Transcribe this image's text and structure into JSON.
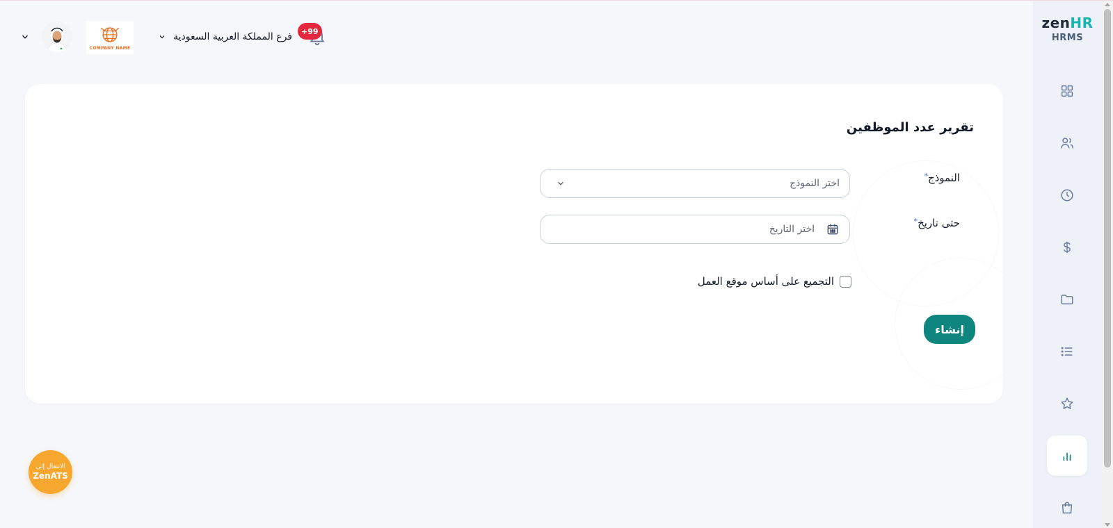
{
  "brand": {
    "logo_main": "zen",
    "logo_accent": "HR",
    "logo_sub": "HRMS",
    "accent_color": "#19b3b0",
    "primary_color": "#0f8580"
  },
  "sidebar": {
    "items": [
      {
        "icon": "dashboard-grid-icon",
        "active": false
      },
      {
        "icon": "users-icon",
        "active": false
      },
      {
        "icon": "clock-icon",
        "active": false
      },
      {
        "icon": "dollar-icon",
        "active": false
      },
      {
        "icon": "folder-icon",
        "active": false
      },
      {
        "icon": "list-icon",
        "active": false
      },
      {
        "icon": "star-icon",
        "active": false
      },
      {
        "icon": "bar-chart-icon",
        "active": true
      },
      {
        "icon": "shopping-bag-icon",
        "active": false
      }
    ]
  },
  "header": {
    "notifications_badge": "+99",
    "branch_label": "فرع المملكة العربية السعودية",
    "company_logo_text": "COMPANY NAME"
  },
  "report": {
    "title": "تقرير عدد الموظفين",
    "template_label": "النموذج",
    "template_required": "*",
    "template_placeholder": "اختر النموذج",
    "date_label": "حتى تاريخ",
    "date_required": "*",
    "date_placeholder": "اختر التاريخ",
    "group_by_location_label": "التجميع على أساس موقع العمل",
    "group_by_location_checked": false,
    "create_button": "إنشاء"
  },
  "ats_button": {
    "line1": "الانتقال إلى",
    "line2": "ZenATS"
  }
}
